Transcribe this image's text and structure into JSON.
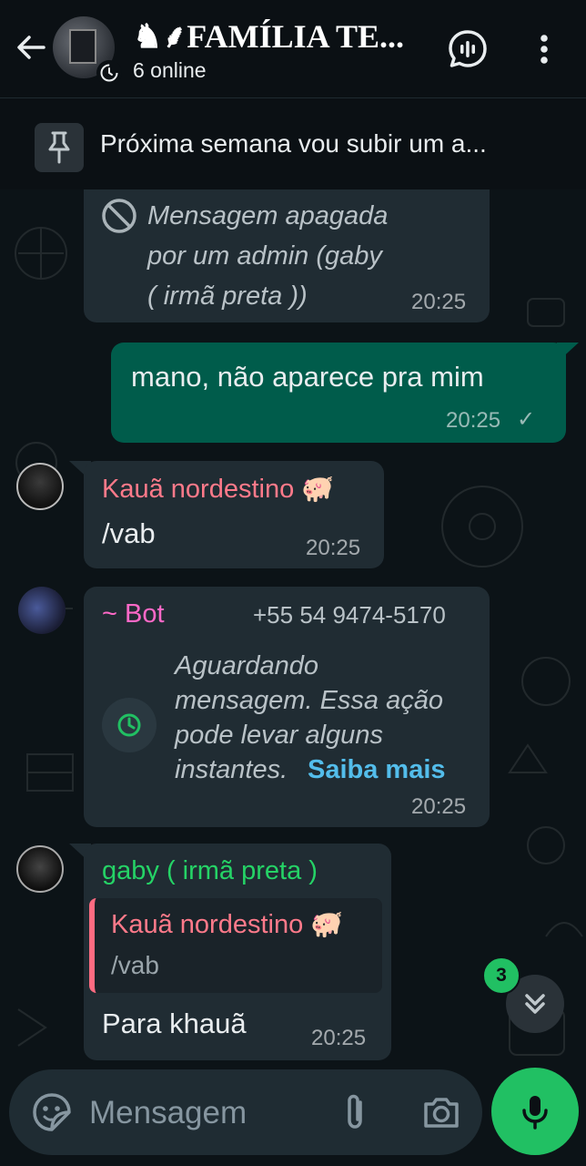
{
  "header": {
    "title": "♞⸙FAMÍLIA TE...",
    "subtitle": "6 online"
  },
  "pinned": {
    "text": "Próxima semana vou subir um a..."
  },
  "messages": [
    {
      "type": "deleted",
      "text_lines": [
        "Mensagem apagada",
        "por um admin (gaby",
        "( irmã preta ))"
      ],
      "time": "20:25"
    },
    {
      "type": "outgoing",
      "text": "mano, não aparece pra mim",
      "time": "20:25",
      "status": "✓"
    },
    {
      "type": "incoming",
      "sender": "Kauã nordestino 🐖",
      "sender_color": "#ff7a8a",
      "text": "/vab",
      "time": "20:25"
    },
    {
      "type": "waiting",
      "sender": "~ Bot",
      "sender_color": "#ff69c8",
      "phone": "+55 54 9474-5170",
      "text_lines": [
        "Aguardando",
        "mensagem. Essa ação",
        "pode levar alguns",
        "instantes."
      ],
      "link": "Saiba mais",
      "link_color": "#53bdeb",
      "time": "20:25"
    },
    {
      "type": "reply",
      "sender": "gaby ( irmã preta )",
      "sender_color": "#25d366",
      "quoted_sender": "Kauã nordestino 🐖",
      "quoted_text": "/vab",
      "text": "Para khauã",
      "time": "20:25"
    }
  ],
  "unread_count": "3",
  "composer": {
    "placeholder": "Mensagem"
  },
  "icons": {
    "back": "arrow-left-icon",
    "call": "voice-chat-icon",
    "menu": "more-vert-icon",
    "pin": "pin-icon",
    "deleted": "block-icon",
    "clock": "clock-icon",
    "scroll": "double-chevron-down-icon",
    "sticker": "sticker-icon",
    "attach": "paperclip-icon",
    "camera": "camera-icon",
    "mic": "microphone-icon"
  },
  "colors": {
    "header_bg": "#0b1014",
    "chat_bg": "#0c1317",
    "incoming_bubble": "#202c33",
    "outgoing_bubble": "#005c4b",
    "accent_green": "#21c063"
  }
}
